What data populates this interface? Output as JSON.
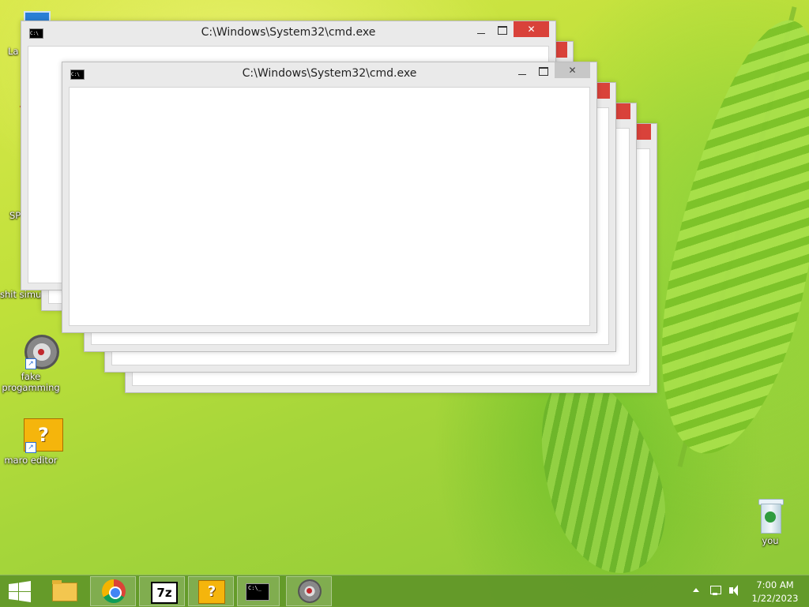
{
  "desktop": {
    "icons": [
      {
        "id": "laptop",
        "label": "La"
      },
      {
        "id": "sp",
        "label": "SP"
      },
      {
        "id": "shit",
        "label": "shit simul"
      },
      {
        "id": "fake",
        "label": "fake progamming"
      },
      {
        "id": "maro",
        "label": "maro editor"
      },
      {
        "id": "recycle",
        "label": "you"
      }
    ]
  },
  "windows": [
    {
      "title": "C:\\Windows\\System32\\cmd.exe"
    },
    {
      "title": "C:\\Windows\\System32\\cmd.exe"
    }
  ],
  "window_controls": {
    "close": "✕"
  },
  "taskbar": {
    "apps": [
      {
        "name": "file-explorer"
      },
      {
        "name": "chrome"
      },
      {
        "name": "7zip",
        "label": "7z"
      },
      {
        "name": "question-block",
        "label": "?"
      },
      {
        "name": "cmd",
        "label": "C:\\_"
      },
      {
        "name": "fake-programming"
      }
    ],
    "clock": {
      "time": "7:00 AM",
      "date": "1/22/2023"
    }
  },
  "colors": {
    "close_red": "#d9423a",
    "taskbar": "#5f9628"
  }
}
